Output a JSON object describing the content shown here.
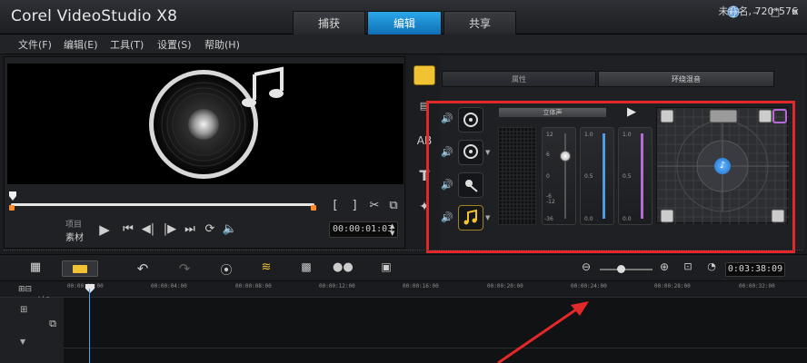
{
  "window": {
    "title": "Corel VideoStudio X8",
    "project": "未命名, 720*576"
  },
  "tabs": [
    {
      "label": "捕获"
    },
    {
      "label": "编辑",
      "active": true
    },
    {
      "label": "共享"
    }
  ],
  "menu": [
    "文件(F)",
    "编辑(E)",
    "工具(T)",
    "设置(S)",
    "帮助(H)"
  ],
  "player": {
    "mode_labels": [
      "项目",
      "素材"
    ],
    "timecode": "00:00:01:03",
    "controls": [
      "play-icon",
      "home-icon",
      "prev-frame-icon",
      "next-frame-icon",
      "end-icon",
      "repeat-icon",
      "volume-icon"
    ],
    "trim_marks": [
      "[",
      "]"
    ]
  },
  "options": {
    "tabs": [
      {
        "label": "属性"
      },
      {
        "label": "环绕混音",
        "active": true
      }
    ],
    "preset_label": "立体声",
    "faders": [
      {
        "ticks": [
          "12",
          "6",
          "0",
          "-6",
          "-12",
          "-36"
        ],
        "color": "#c8c8c8",
        "level": 0.78
      },
      {
        "ticks": [
          "1.0",
          "0.5",
          "0.0"
        ],
        "color": "#4f9be0",
        "level": 0.0
      },
      {
        "ticks": [
          "1.0",
          "0.5",
          "0.0"
        ],
        "color": "#b56ad8",
        "level": 0.0
      }
    ]
  },
  "timeline": {
    "total_duration": "0:03:38:09",
    "ruler_ticks": [
      "00:00:00:00",
      "00:00:04:00",
      "00:00:08:00",
      "00:00:12:00",
      "00:00:16:00",
      "00:00:20:00",
      "00:00:24:00",
      "00:00:28:00",
      "00:00:32:00"
    ],
    "zoom_level": 0.4
  },
  "colors": {
    "accent": "#1a8ad4",
    "highlight": "#e3282a",
    "gold": "#f1c232"
  }
}
